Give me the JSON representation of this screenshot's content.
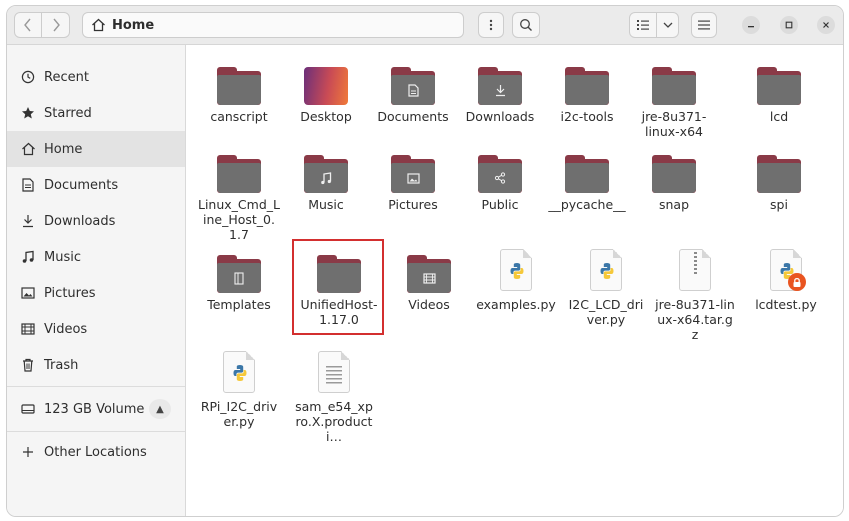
{
  "header": {
    "path_label": "Home"
  },
  "sidebar": {
    "items": [
      {
        "label": "Recent",
        "icon": "clock-icon"
      },
      {
        "label": "Starred",
        "icon": "star-icon"
      },
      {
        "label": "Home",
        "icon": "home-icon"
      },
      {
        "label": "Documents",
        "icon": "document-icon"
      },
      {
        "label": "Downloads",
        "icon": "download-icon"
      },
      {
        "label": "Music",
        "icon": "music-icon"
      },
      {
        "label": "Pictures",
        "icon": "picture-icon"
      },
      {
        "label": "Videos",
        "icon": "video-icon"
      },
      {
        "label": "Trash",
        "icon": "trash-icon"
      },
      {
        "label": "123 GB Volume",
        "icon": "drive-icon"
      },
      {
        "label": "Other Locations",
        "icon": "plus-icon"
      }
    ]
  },
  "files": [
    {
      "name": "canscript",
      "type": "folder"
    },
    {
      "name": "Desktop",
      "type": "desktop-folder"
    },
    {
      "name": "Documents",
      "type": "folder",
      "emblem": "document-icon"
    },
    {
      "name": "Downloads",
      "type": "folder",
      "emblem": "download-icon"
    },
    {
      "name": "i2c-tools",
      "type": "folder"
    },
    {
      "name": "jre-8u371-linux-x64",
      "type": "folder"
    },
    {
      "name": "lcd",
      "type": "folder"
    },
    {
      "name": "Linux_Cmd_Line_Host_0.1.7",
      "type": "folder"
    },
    {
      "name": "Music",
      "type": "folder",
      "emblem": "music-icon"
    },
    {
      "name": "Pictures",
      "type": "folder",
      "emblem": "picture-icon"
    },
    {
      "name": "Public",
      "type": "folder",
      "emblem": "share-icon"
    },
    {
      "name": "__pycache__",
      "type": "folder"
    },
    {
      "name": "snap",
      "type": "folder"
    },
    {
      "name": "spi",
      "type": "folder"
    },
    {
      "name": "Templates",
      "type": "folder",
      "emblem": "template-icon"
    },
    {
      "name": "UnifiedHost-1.17.0",
      "type": "folder"
    },
    {
      "name": "Videos",
      "type": "folder",
      "emblem": "video-icon"
    },
    {
      "name": "examples.py",
      "type": "python-file"
    },
    {
      "name": "I2C_LCD_driver.py",
      "type": "python-file"
    },
    {
      "name": "jre-8u371-linux-x64.tar.gz",
      "type": "archive-file"
    },
    {
      "name": "lcdtest.py",
      "type": "python-file-locked"
    },
    {
      "name": "RPi_I2C_driver.py",
      "type": "python-file"
    },
    {
      "name": "sam_e54_xpro.X.producti…",
      "type": "text-file"
    }
  ],
  "colors": {
    "folder_tab": "#8a3a47",
    "folder_body": "#6f6f6f",
    "selection_outline": "#d32f2f",
    "lock_badge": "#e95420"
  }
}
